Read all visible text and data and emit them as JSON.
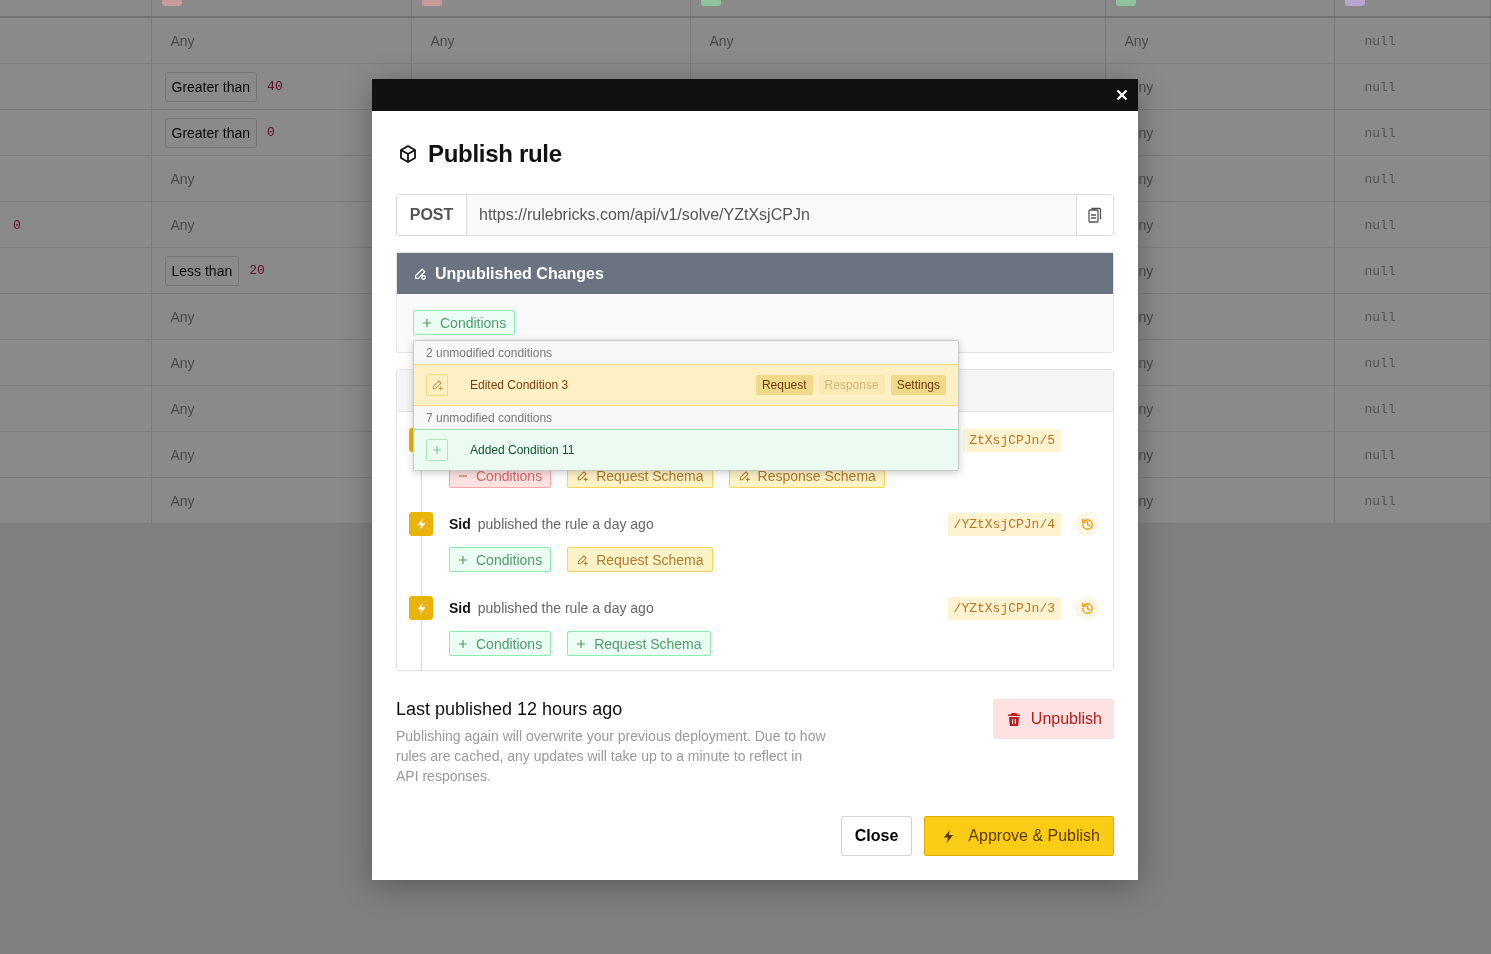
{
  "table": {
    "columns": [
      {
        "kind": "plain"
      },
      {
        "kind": "tagged",
        "color": "#c99a9a"
      },
      {
        "kind": "tagged",
        "color": "#c99a9a"
      },
      {
        "kind": "tagged",
        "color": "#8fc29a"
      },
      {
        "kind": "tagged",
        "color": "#8fc29a"
      },
      {
        "kind": "tagged",
        "color": "#b8a4cc"
      }
    ],
    "rows": [
      {
        "cells": [
          {
            "kind": "empty"
          },
          {
            "kind": "any",
            "text": "Any"
          },
          {
            "kind": "any",
            "text": "Any"
          },
          {
            "kind": "any",
            "text": "Any"
          },
          {
            "kind": "any",
            "text": "Any"
          },
          {
            "kind": "null",
            "text": "null"
          }
        ]
      },
      {
        "cells": [
          {
            "kind": "empty"
          },
          {
            "kind": "comparison",
            "operator": "Greater than",
            "value": "40"
          },
          {
            "kind": "empty"
          },
          {
            "kind": "empty"
          },
          {
            "kind": "clipped",
            "text": "ny"
          },
          {
            "kind": "null",
            "text": "null"
          }
        ]
      },
      {
        "cells": [
          {
            "kind": "empty"
          },
          {
            "kind": "comparison",
            "operator": "Greater than",
            "value": "0"
          },
          {
            "kind": "empty"
          },
          {
            "kind": "empty"
          },
          {
            "kind": "clipped",
            "text": "ny"
          },
          {
            "kind": "null",
            "text": "null"
          }
        ]
      },
      {
        "cells": [
          {
            "kind": "empty"
          },
          {
            "kind": "any",
            "text": "Any"
          },
          {
            "kind": "empty"
          },
          {
            "kind": "empty"
          },
          {
            "kind": "clipped",
            "text": "ny"
          },
          {
            "kind": "null",
            "text": "null"
          }
        ]
      },
      {
        "cells": [
          {
            "kind": "value",
            "value": "0"
          },
          {
            "kind": "any",
            "text": "Any"
          },
          {
            "kind": "empty"
          },
          {
            "kind": "empty"
          },
          {
            "kind": "clipped",
            "text": "ny"
          },
          {
            "kind": "null",
            "text": "null"
          }
        ]
      },
      {
        "cells": [
          {
            "kind": "empty"
          },
          {
            "kind": "comparison",
            "operator": "Less than",
            "value": "20"
          },
          {
            "kind": "empty"
          },
          {
            "kind": "empty"
          },
          {
            "kind": "clipped",
            "text": "ny"
          },
          {
            "kind": "null",
            "text": "null"
          }
        ]
      },
      {
        "cells": [
          {
            "kind": "empty"
          },
          {
            "kind": "any",
            "text": "Any"
          },
          {
            "kind": "empty"
          },
          {
            "kind": "empty"
          },
          {
            "kind": "clipped",
            "text": "ny"
          },
          {
            "kind": "null",
            "text": "null"
          }
        ]
      },
      {
        "cells": [
          {
            "kind": "empty"
          },
          {
            "kind": "any",
            "text": "Any"
          },
          {
            "kind": "empty"
          },
          {
            "kind": "empty"
          },
          {
            "kind": "clipped",
            "text": "ny"
          },
          {
            "kind": "null",
            "text": "null"
          }
        ]
      },
      {
        "cells": [
          {
            "kind": "empty"
          },
          {
            "kind": "any",
            "text": "Any"
          },
          {
            "kind": "empty"
          },
          {
            "kind": "empty"
          },
          {
            "kind": "clipped",
            "text": "ny"
          },
          {
            "kind": "null",
            "text": "null"
          }
        ]
      },
      {
        "cells": [
          {
            "kind": "empty"
          },
          {
            "kind": "any",
            "text": "Any"
          },
          {
            "kind": "empty"
          },
          {
            "kind": "empty"
          },
          {
            "kind": "clipped",
            "text": "ny"
          },
          {
            "kind": "null",
            "text": "null"
          }
        ]
      },
      {
        "cells": [
          {
            "kind": "empty"
          },
          {
            "kind": "any",
            "text": "Any"
          },
          {
            "kind": "empty"
          },
          {
            "kind": "empty"
          },
          {
            "kind": "clipped",
            "text": "ny"
          },
          {
            "kind": "null",
            "text": "null"
          }
        ]
      }
    ]
  },
  "modal": {
    "title": "Publish rule",
    "endpoint": {
      "method": "POST",
      "url": "https://rulebricks.com/api/v1/solve/YZtXsjCPJn"
    },
    "unpublished": {
      "title": "Unpublished Changes",
      "changes": [
        {
          "kind": "added",
          "label": "Conditions"
        }
      ],
      "dropdown": [
        {
          "kind": "header",
          "text": "2 unmodified conditions"
        },
        {
          "kind": "edited",
          "label": "Edited Condition 3",
          "tags": [
            {
              "label": "Request",
              "changed": true
            },
            {
              "label": "Response",
              "changed": false
            },
            {
              "label": "Settings",
              "changed": true
            }
          ]
        },
        {
          "kind": "header",
          "text": "7 unmodified conditions"
        },
        {
          "kind": "added",
          "label": "Added Condition 11"
        }
      ]
    },
    "history": [
      {
        "version": "ZtXsjCPJn/5",
        "restorable": false,
        "changes": [
          {
            "kind": "removed",
            "label": "Conditions"
          },
          {
            "kind": "edited",
            "label": "Request Schema"
          },
          {
            "kind": "edited",
            "label": "Response Schema"
          }
        ]
      },
      {
        "actor": "Sid",
        "action": "published the rule a day ago",
        "version": "/YZtXsjCPJn/4",
        "restorable": true,
        "changes": [
          {
            "kind": "added",
            "label": "Conditions"
          },
          {
            "kind": "edited",
            "label": "Request Schema"
          }
        ]
      },
      {
        "actor": "Sid",
        "action": "published the rule a day ago",
        "version": "/YZtXsjCPJn/3",
        "restorable": true,
        "changes": [
          {
            "kind": "added",
            "label": "Conditions"
          },
          {
            "kind": "added",
            "label": "Request Schema"
          }
        ]
      }
    ],
    "footer": {
      "heading": "Last published 12 hours ago",
      "note": "Publishing again will overwrite your previous deployment. Due to how rules are cached, any updates will take up to a minute to reflect in API responses.",
      "unpublish": "Unpublish",
      "close": "Close",
      "approve": "Approve & Publish"
    }
  }
}
